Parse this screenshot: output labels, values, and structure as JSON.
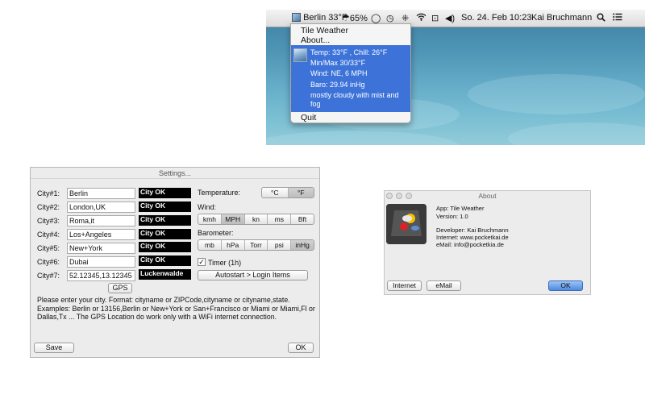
{
  "menubar": {
    "weather_status": "Berlin 33°F",
    "battery": "65%",
    "datetime": "So. 24. Feb  10:23",
    "user": "Kai Bruchmann"
  },
  "menu": {
    "app_title": "Tile Weather",
    "about": "About...",
    "temp": "Temp: 33°F , Chill: 26°F",
    "minmax": "Min/Max 30/33°F",
    "wind": "Wind: NE, 6 MPH",
    "baro": "Baro: 29.94 inHg",
    "condition": "mostly cloudy with mist and fog",
    "quit": "Quit"
  },
  "settings": {
    "title": "Settings...",
    "cities": [
      {
        "label": "City#1:",
        "value": "Berlin",
        "status": "City OK"
      },
      {
        "label": "City#2:",
        "value": "London,UK",
        "status": "City OK"
      },
      {
        "label": "City#3:",
        "value": "Roma,it",
        "status": "City OK"
      },
      {
        "label": "City#4:",
        "value": "Los+Angeles",
        "status": "City OK"
      },
      {
        "label": "City#5:",
        "value": "New+York",
        "status": "City OK"
      },
      {
        "label": "City#6:",
        "value": "Dubai",
        "status": "City OK"
      },
      {
        "label": "City#7:",
        "value": "52.12345,13.12345",
        "status": "Luckenwalde"
      }
    ],
    "temperature_label": "Temperature:",
    "temperature_options": [
      "°C",
      "°F"
    ],
    "temperature_selected": "°F",
    "wind_label": "Wind:",
    "wind_options": [
      "kmh",
      "MPH",
      "kn",
      "ms",
      "Bft"
    ],
    "wind_selected": "MPH",
    "barometer_label": "Barometer:",
    "barometer_options": [
      "mb",
      "hPa",
      "Torr",
      "psi",
      "inHg"
    ],
    "barometer_selected": "inHg",
    "timer_label": "Timer (1h)",
    "timer_checked": true,
    "autostart_label": "Autostart > Login Items",
    "gps_label": "GPS",
    "help_text": "Please enter your city. Format: cityname  or ZIPCode,cityname or cityname,state. Examples: Berlin  or 13156,Berlin or New+York or San+Francisco or Miami or Miami,Fl or Dallas,Tx ... The GPS Location do work only with a WiFi internet connection.",
    "save_label": "Save",
    "ok_label": "OK"
  },
  "about": {
    "title": "About",
    "app": "App: Tile Weather",
    "version": "Version: 1.0",
    "developer": "Developer: Kai Bruchmann",
    "internet": "Internet: www.pocketkai.de",
    "email": "eMail: info@pocketkia.de",
    "internet_btn": "Internet",
    "email_btn": "eMail",
    "ok_btn": "OK",
    "accent": "#3d73d9"
  }
}
